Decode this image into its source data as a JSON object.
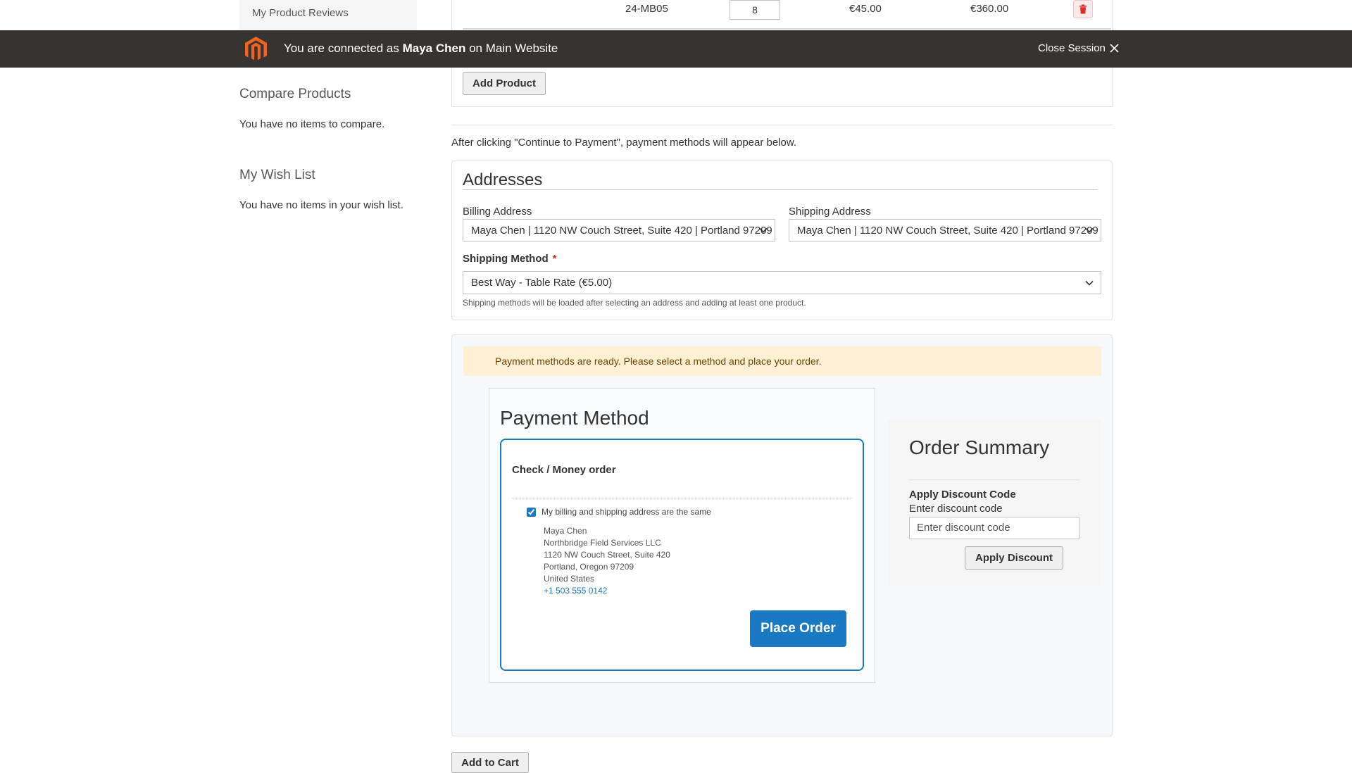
{
  "sidebar": {
    "my_reviews": "My Product Reviews",
    "compare_title": "Compare Products",
    "compare_text": "You have no items to compare.",
    "wishlist_title": "My Wish List",
    "wishlist_text": "You have no items in your wish list."
  },
  "product_row": {
    "sku": "24-MB05",
    "qty": "8",
    "price": "€45.00",
    "subtotal": "€360.00"
  },
  "session": {
    "prefix": "You are connected as",
    "customer": "Maya Chen",
    "middle": "on",
    "website": "Main Website",
    "close_label": "Close Session"
  },
  "add_product_label": "Add Product",
  "payment_hint": "After clicking \"Continue to Payment\", payment methods will appear below.",
  "addresses": {
    "title": "Addresses",
    "billing_label": "Billing Address",
    "billing_value": "Maya Chen | 1120 NW Couch Street, Suite 420 | Portland 97209",
    "shipping_label": "Shipping Address",
    "shipping_value": "Maya Chen | 1120 NW Couch Street, Suite 420 | Portland 97209",
    "method_label": "Shipping Method",
    "required_mark": "*",
    "method_value": "Best Way - Table Rate (€5.00)",
    "method_hint": "Shipping methods will be loaded after selecting an address and adding at least one product."
  },
  "payment": {
    "notice": "Payment methods are ready. Please select a method and place your order.",
    "title": "Payment Method",
    "method_name": "Check / Money order",
    "same_address_label": "My billing and shipping address are the same",
    "same_address_checked": true,
    "address": {
      "name": "Maya Chen",
      "company": "Northbridge Field Services LLC",
      "street": "1120 NW Couch Street, Suite 420",
      "city_line": "Portland, Oregon 97209",
      "country": "United States",
      "phone": "+1 503 555 0142"
    },
    "place_order_label": "Place Order"
  },
  "summary": {
    "title": "Order Summary",
    "discount_title": "Apply Discount Code",
    "discount_label": "Enter discount code",
    "discount_placeholder": "Enter discount code",
    "apply_label": "Apply Discount"
  },
  "add_to_cart_label": "Add to Cart",
  "colors": {
    "session_bar": "#373330",
    "brand_orange": "#f26322",
    "primary_blue": "#1979c3",
    "notice_bg": "#fdf0d5",
    "delete_red": "#e02b27"
  },
  "icons": {
    "logo": "magento-logo-icon",
    "close": "close-icon",
    "trash": "trash-icon",
    "chevron": "chevron-down-icon"
  }
}
